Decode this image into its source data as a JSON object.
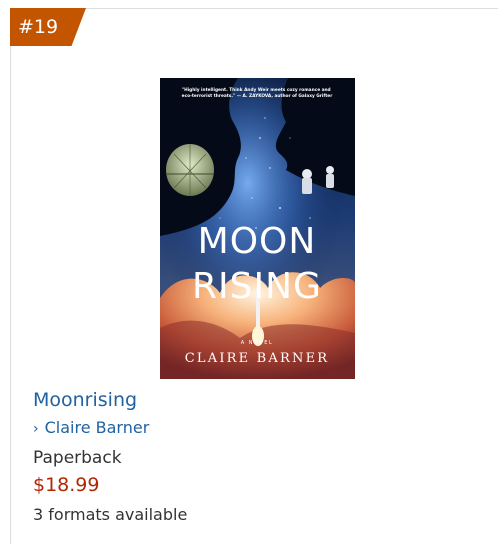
{
  "badge": {
    "rank": "#19",
    "color": "#c45500"
  },
  "product": {
    "cover": {
      "blurb": "\"Highly intelligent. Think Andy Weir meets cozy romance and eco-terrorist threats.\" — A. ZAYKOVA, author of Galaxy Grifter",
      "title_line1": "MOON",
      "title_line2": "RISING",
      "tagline": "A NOVEL",
      "author": "CLAIRE BARNER"
    },
    "title": "Moonrising",
    "author_chevron": "›",
    "author": "Claire Barner",
    "format": "Paperback",
    "price": "$18.99",
    "formats_available": "3 formats available"
  },
  "colors": {
    "link": "#2162a1",
    "price": "#b12704",
    "text": "#333333"
  }
}
